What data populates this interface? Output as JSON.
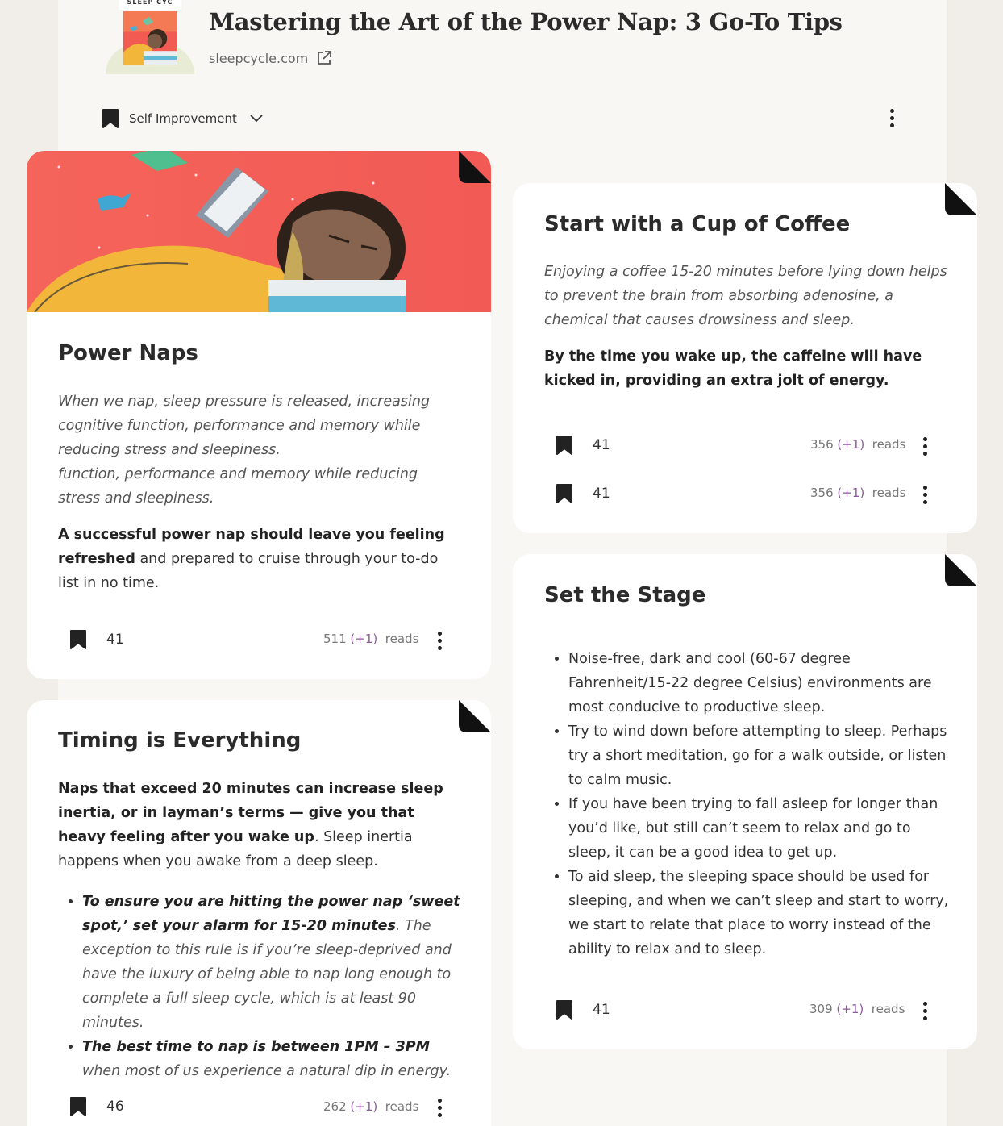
{
  "header": {
    "thumb_label": "SLEEP CYC",
    "title": "Mastering the Art of the Power Nap: 3 Go-To Tips",
    "source": "sleepcycle.com",
    "category": "Self Improvement"
  },
  "cards": {
    "power_naps": {
      "title": "Power Naps",
      "italic_1": "When we nap, sleep pressure is released, increasing cognitive function, performance and memory while reducing stress and sleepiness.",
      "italic_2": "function, performance and memory while reducing stress and sleepiness.",
      "bold_part": "A successful power nap should leave you feeling refreshed",
      "rest_part": " and prepared to cruise through your to-do list in no time.",
      "saves": "41",
      "reads_count": "511",
      "reads_plus": "(+1)",
      "reads_label": "reads"
    },
    "timing": {
      "title": "Timing is Everything",
      "bold_part": "Naps that exceed 20 minutes can increase sleep inertia, or in layman’s terms — give you that heavy feeling after you wake up",
      "rest_part": ". Sleep inertia happens when you awake from a deep sleep.",
      "bullet1_bold": "To ensure you are hitting the power nap ‘sweet spot,’ set your alarm for 15-20 minutes",
      "bullet1_rest": ". The exception to this rule is if you’re sleep-deprived and have the luxury of being able to nap long enough to complete a full sleep cycle, which is at least 90 minutes.",
      "bullet2_bold": "The best time to nap is between 1PM – 3PM",
      "bullet2_rest": " when most of us experience a natural dip in energy.",
      "saves": "46",
      "reads_count": "262",
      "reads_plus": "(+1)",
      "reads_label": "reads"
    },
    "coffee": {
      "title": "Start with a Cup of Coffee",
      "italic": "Enjoying a coffee 15-20 minutes before lying down helps to prevent the brain from absorbing adenosine, a chemical that causes drowsiness and sleep.",
      "bold": "By the time you wake up, the caffeine will have kicked in, providing an extra jolt of energy.",
      "saves": "41",
      "reads_count": "356",
      "reads_plus": "(+1)",
      "reads_label": "reads",
      "saves_2": "41",
      "reads_count_2": "356",
      "reads_plus_2": "(+1)",
      "reads_label_2": "reads"
    },
    "stage": {
      "title": "Set the Stage",
      "bullets": [
        "Noise-free, dark and cool (60-67 degree Fahrenheit/15-22 degree Celsius) environments are most conducive to productive sleep.",
        "Try to wind down before attempting to sleep. Perhaps try a short meditation, go for a walk outside, or listen to calm music.",
        "If you have been trying to fall asleep for longer than you’d like, but still can’t seem to relax and go to sleep, it can be a good idea to get up.",
        "To aid sleep, the sleeping space should be used for sleeping, and when we can’t sleep and start to worry, we start to relate that place to worry instead of the ability to relax and to sleep."
      ],
      "saves": "41",
      "reads_count": "309",
      "reads_plus": "(+1)",
      "reads_label": "reads"
    }
  },
  "colors": {
    "background": "#f1eee9",
    "panel": "#f9f7f3",
    "card": "#ffffff",
    "accent_plus": "#8a5a9a",
    "illustration_bg": "#f45a55"
  },
  "icons": [
    "bookmark-icon",
    "external-link-icon",
    "chevron-down-icon",
    "more-vertical-icon",
    "page-fold-icon"
  ]
}
